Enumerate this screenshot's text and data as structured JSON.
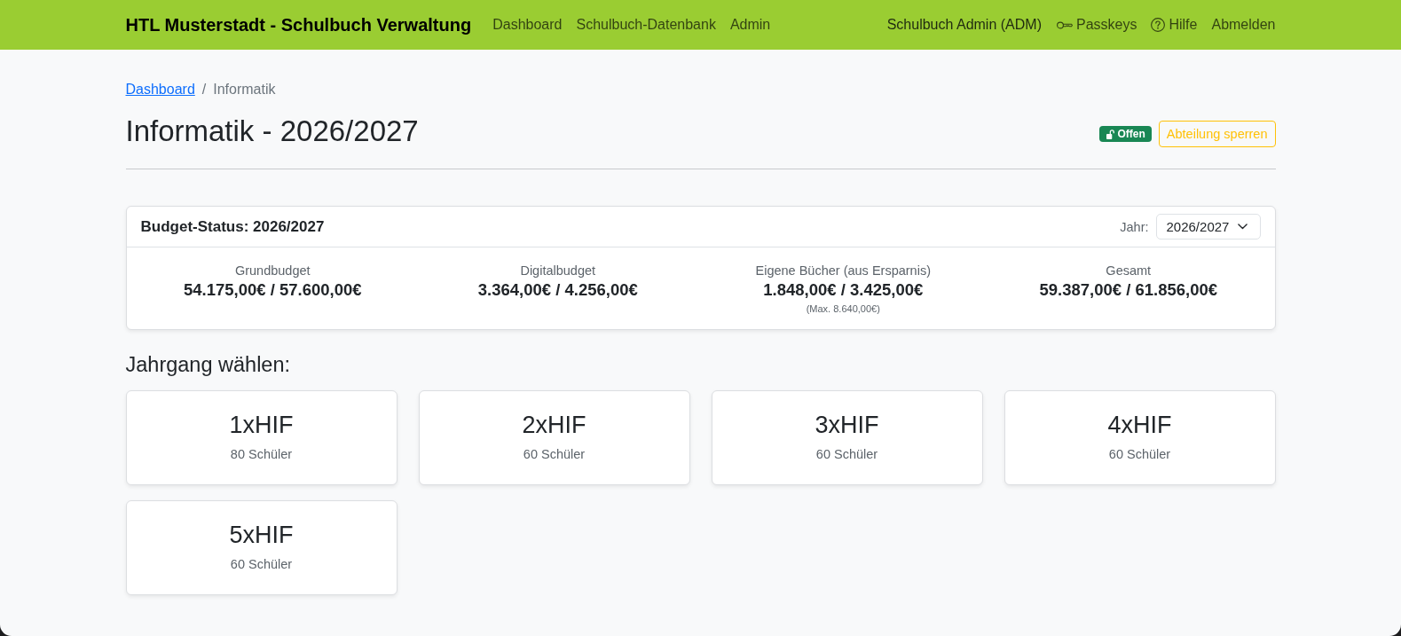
{
  "navbar": {
    "brand": "HTL Musterstadt - Schulbuch Verwaltung",
    "links": [
      "Dashboard",
      "Schulbuch-Datenbank",
      "Admin"
    ],
    "user": "Schulbuch Admin (ADM)",
    "actions": [
      {
        "kind": "passkeys",
        "label": "Passkeys"
      },
      {
        "kind": "help",
        "label": "Hilfe"
      },
      {
        "kind": "logout",
        "label": "Abmelden"
      }
    ]
  },
  "breadcrumb": {
    "items": [
      {
        "kind": "link",
        "label": "Dashboard"
      },
      {
        "kind": "current",
        "label": "Informatik"
      }
    ],
    "separator": "/"
  },
  "header": {
    "title": "Informatik - 2026/2027",
    "status_badge": {
      "label": "Offen",
      "locked": false
    },
    "lock_button": "Abteilung sperren"
  },
  "budget": {
    "title": "Budget-Status: 2026/2027",
    "year_label": "Jahr:",
    "year_select": "2026/2027",
    "items": [
      {
        "label": "Grundbudget",
        "value": "54.175,00€ / 57.600,00€"
      },
      {
        "label": "Digitalbudget",
        "value": "3.364,00€ / 4.256,00€"
      },
      {
        "label": "Eigene Bücher (aus Ersparnis)",
        "value": "1.848,00€ / 3.425,00€",
        "note": "(Max. 8.640,00€)"
      },
      {
        "label": "Gesamt",
        "value": "59.387,00€ / 61.856,00€"
      }
    ]
  },
  "classes": {
    "heading": "Jahrgang wählen:",
    "items": [
      {
        "name": "1xHIF",
        "students": "80 Schüler"
      },
      {
        "name": "2xHIF",
        "students": "60 Schüler"
      },
      {
        "name": "3xHIF",
        "students": "60 Schüler"
      },
      {
        "name": "4xHIF",
        "students": "60 Schüler"
      },
      {
        "name": "5xHIF",
        "students": "60 Schüler"
      }
    ]
  }
}
